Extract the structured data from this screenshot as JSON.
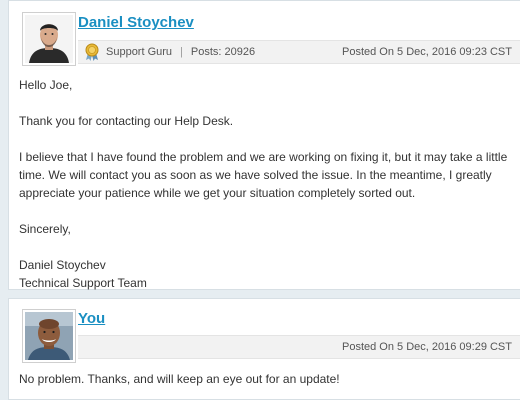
{
  "posts": [
    {
      "author": "Daniel Stoychev",
      "role": "Support Guru",
      "posts_label": "Posts: 20926",
      "date": "Posted On 5 Dec, 2016 09:23 CST",
      "body": {
        "greeting": "Hello Joe,",
        "p1": "Thank you for contacting our Help Desk.",
        "p2": "I believe that I have found the problem and we are working on fixing it, but it may take a little time. We will contact you as soon as we have solved the issue. In the meantime, I greatly appreciate your patience while we get your situation completely sorted out.",
        "closing": "Sincerely,",
        "sig_name": "Daniel Stoychev",
        "sig_team": "Technical Support Team"
      },
      "avatar_icon": "agent-avatar"
    },
    {
      "author": "You",
      "date": "Posted On 5 Dec, 2016 09:29 CST",
      "body": {
        "text": "No problem. Thanks, and will keep an eye out for an update!"
      },
      "avatar_icon": "user-avatar"
    }
  ],
  "colors": {
    "link": "#1a8fc2",
    "background": "#e6edf1",
    "meta_bar": "#f2f2f2"
  },
  "icons": {
    "role_badge": "award-ribbon-icon"
  }
}
